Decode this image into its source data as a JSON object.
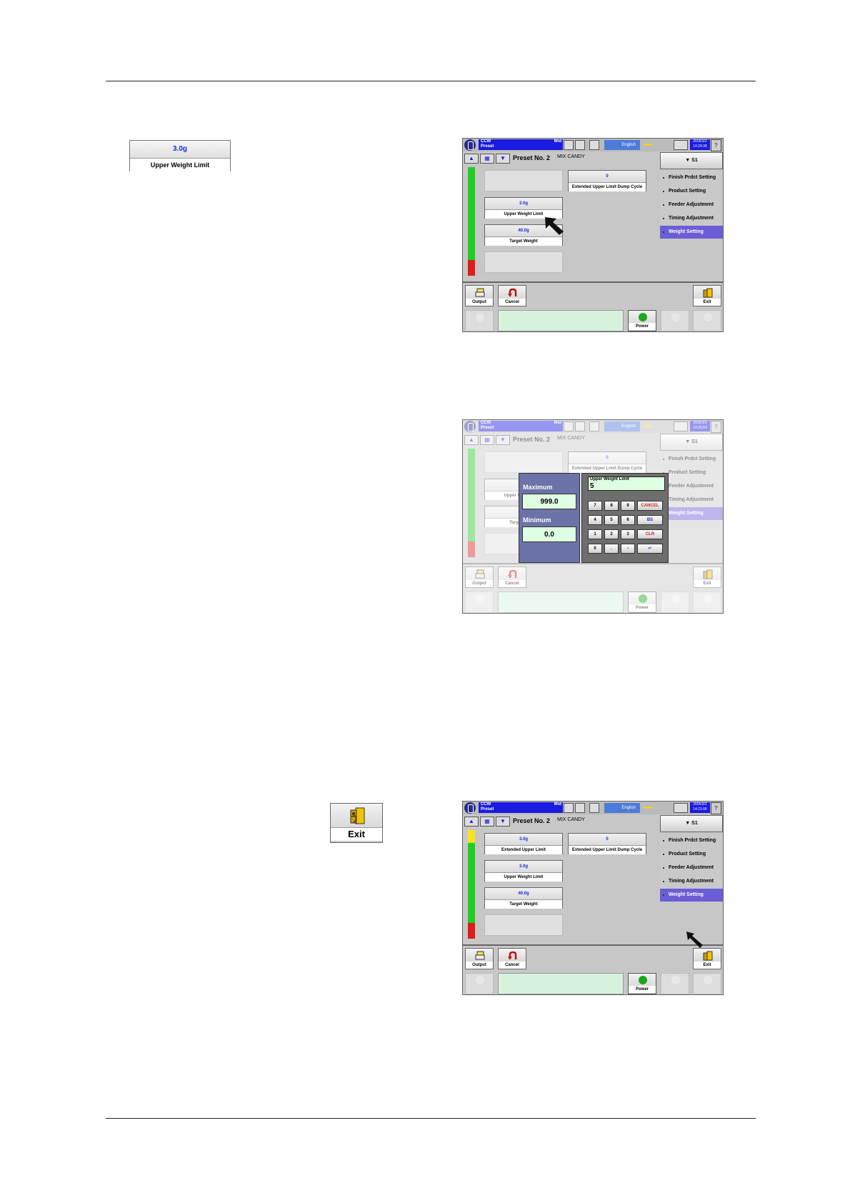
{
  "callout_uwl": {
    "value": "3.0g",
    "label": "Upper Weight Limit"
  },
  "callout_exit": {
    "label": "Exit"
  },
  "hmi": {
    "mode_line1": "CCW",
    "mode_line2": "Preset",
    "mode_tag": "Mid",
    "language": "English",
    "preset_label": "Preset No.  2",
    "product_name": "MIX CANDY",
    "s_button": "▼ S1",
    "menu": [
      "Finish Prdct Setting",
      "Product Setting",
      "Feeder Adjustment",
      "Timing Adjustment",
      "Weight Setting"
    ],
    "buttons": {
      "ext_upper_limit": "Extended Upper Limit",
      "ext_upper_dump": "Extended Upper Limit Dump Cycle",
      "upper_weight_limit": "Upper Weight Limit",
      "target_weight": "Target Weight"
    },
    "values": {
      "ext_upper_limit": "3.0g",
      "ext_upper_dump": "0",
      "upper_weight_limit": "3.0g",
      "target_weight": "40.0g"
    },
    "bottom": {
      "output": "Output",
      "cancel": "Cancel",
      "exit": "Exit",
      "power": "Power"
    },
    "keypad": {
      "maximum_label": "Maximum",
      "maximum_value": "999.0",
      "minimum_label": "Minimum",
      "minimum_value": "0.0",
      "field_title": "Upper Weight Limit",
      "input_value": "5",
      "keys": [
        "7",
        "8",
        "9",
        "CANCEL",
        "4",
        "5",
        "6",
        "BS",
        "1",
        "2",
        "3",
        "CLR",
        "0",
        ".",
        "-",
        "↵"
      ]
    },
    "colors": {
      "accent_blue": "#1a1ae0",
      "selected_menu": "#6a5ed6",
      "green_bar": "#22cc22",
      "red_bar": "#e01b1b"
    }
  }
}
